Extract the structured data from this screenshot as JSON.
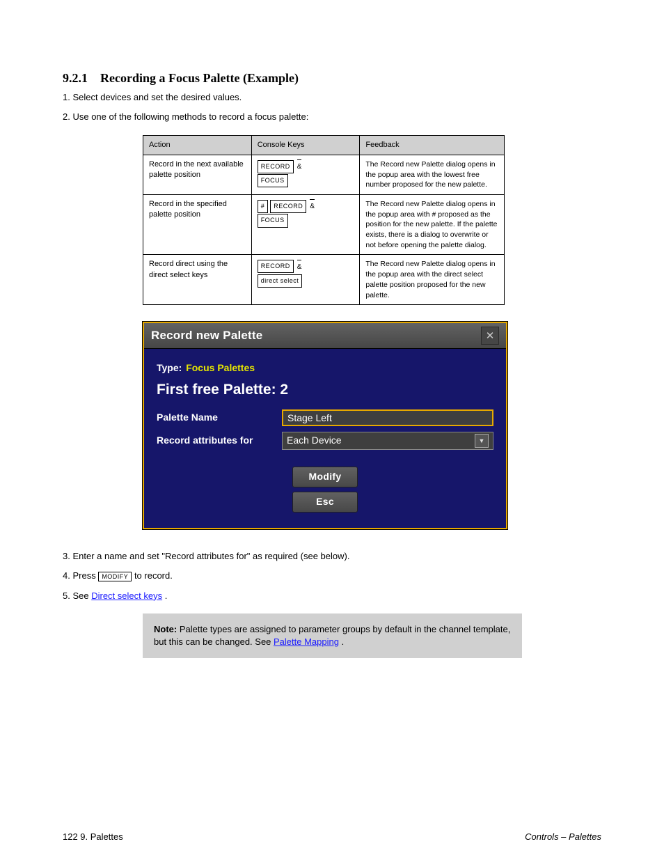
{
  "section": {
    "number": "9.2.1",
    "title": "Recording a Focus Palette (Example)",
    "intro1": "Select devices and set the desired values.",
    "intro2": "Use one of the following methods to record a focus palette:"
  },
  "table": {
    "headers": {
      "action": "Action",
      "command": "Console Keys",
      "feedback": "Feedback"
    },
    "rows": [
      {
        "action": "Record in the next available palette position",
        "keys": [
          [
            "RECORD",
            "&"
          ],
          [
            "FOCUS"
          ]
        ],
        "feedback": "The Record new Palette dialog opens in the popup area with the lowest free number proposed for the new palette."
      },
      {
        "action": "Record in the specified palette position",
        "keys": [
          [
            "#",
            "RECORD",
            "&"
          ],
          [
            "FOCUS"
          ]
        ],
        "feedback": "The Record new Palette dialog opens in the popup area with # proposed as the position for the new palette. If the palette exists, there is a dialog to overwrite or not before opening the palette dialog."
      },
      {
        "action": "Record direct using the direct select keys",
        "keys": [
          [
            "RECORD",
            "&"
          ],
          [
            "direct select"
          ]
        ],
        "feedback": "The Record new Palette dialog opens in the popup area with the direct select palette position proposed for the new palette."
      }
    ]
  },
  "dialog": {
    "title": "Record new Palette",
    "type_label": "Type:",
    "type_value": "Focus Palettes",
    "heading": "First free Palette: 2",
    "name_label": "Palette Name",
    "name_value": "Stage Left",
    "attr_label": "Record attributes for",
    "attr_value": "Each Device",
    "btn_modify": "Modify",
    "btn_esc": "Esc"
  },
  "steps": {
    "s3": "Enter a name and set \"Record attributes for\" as required (see below).",
    "s4_prefix": "Press ",
    "s4_key": "MODIFY",
    "s4_suffix": " to record.",
    "s5_prefix": "See ",
    "s5_link": "Direct select keys",
    "s5_suffix": "."
  },
  "note": {
    "label": "Note:",
    "body_prefix": "Palette types are assigned to parameter groups by default in the channel template, but this can be changed. See ",
    "body_link": "Palette Mapping",
    "body_suffix": "."
  },
  "footer": {
    "left": "122  9. Palettes",
    "right": "Controls – Palettes"
  }
}
